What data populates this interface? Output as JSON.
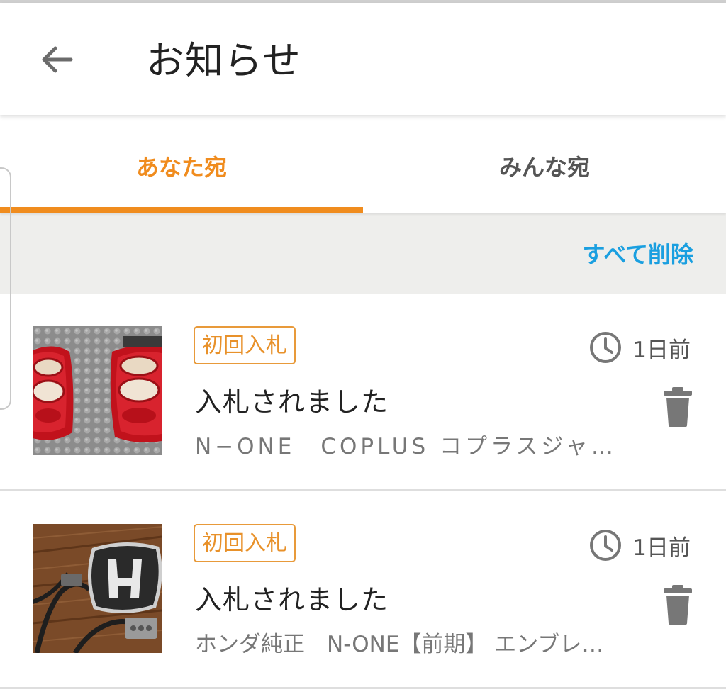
{
  "header": {
    "title": "お知らせ",
    "back_icon": "arrow-left-icon"
  },
  "tabs": [
    {
      "label": "あなた宛",
      "active": true
    },
    {
      "label": "みんな宛",
      "active": false
    }
  ],
  "actions": {
    "delete_all_label": "すべて削除"
  },
  "colors": {
    "accent_orange": "#f08c1e",
    "link_blue": "#1a9fe0",
    "icon_gray": "#777777"
  },
  "notifications": [
    {
      "badge": "初回入札",
      "time": "1日前",
      "title": "入札されました",
      "description": "N−ONE　COPLUS コプラスジャ…",
      "thumbnail_icon": "tail-lights-image",
      "trash_icon": "trash-icon",
      "clock_icon": "clock-icon"
    },
    {
      "badge": "初回入札",
      "time": "1日前",
      "title": "入札されました",
      "description": "ホンダ純正　N-ONE【前期】 エンブレ…",
      "thumbnail_icon": "honda-emblem-image",
      "trash_icon": "trash-icon",
      "clock_icon": "clock-icon"
    }
  ]
}
